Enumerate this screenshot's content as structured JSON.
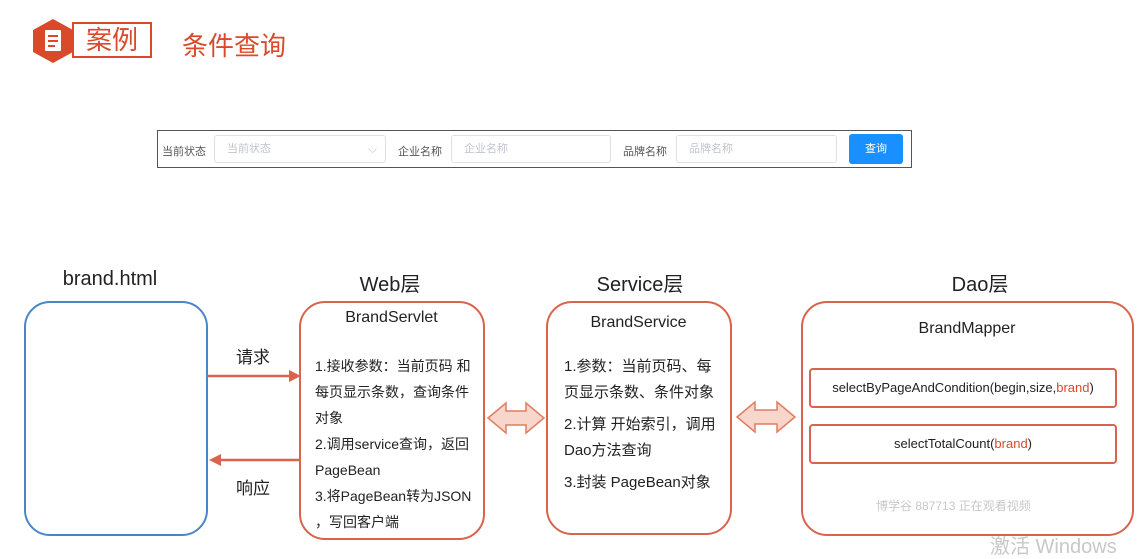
{
  "header": {
    "badge": "案例",
    "title": "条件查询"
  },
  "search_form": {
    "status_label": "当前状态",
    "status_placeholder": "当前状态",
    "company_label": "企业名称",
    "company_placeholder": "企业名称",
    "brand_label": "品牌名称",
    "brand_placeholder": "品牌名称",
    "query_button": "查询"
  },
  "diagram": {
    "col1_label": "brand.html",
    "col2_label": "Web层",
    "col3_label": "Service层",
    "col4_label": "Dao层",
    "request_label": "请求",
    "response_label": "响应",
    "web_box": {
      "title": "BrandServlet",
      "step1_line1": "1.接收参数：当前页码 和",
      "step1_line2": "每页显示条数，查询条件",
      "step1_line3": "对象",
      "step2_line1": "2.调用service查询，返回",
      "step2_line2": "PageBean",
      "step3_line1": "3.将PageBean转为JSON",
      "step3_line2": "，写回客户端"
    },
    "service_box": {
      "title": "BrandService",
      "step1_line1": "1.参数：当前页码、每",
      "step1_line2": "页显示条数、条件对象",
      "step2_line1": "2.计算 开始索引，调用",
      "step2_line2": "Dao方法查询",
      "step3": "3.封装 PageBean对象"
    },
    "dao_box": {
      "title": "BrandMapper",
      "method1_prefix": "selectByPageAndCondition(begin,size,",
      "method1_param": "brand",
      "method1_suffix": ")",
      "method2_prefix": "selectTotalCount(",
      "method2_param": "brand",
      "method2_suffix": ")"
    }
  },
  "watermark": {
    "text1": "博学谷 887713 正在观看视频",
    "text2": "激活 Windows"
  },
  "colors": {
    "accent_red": "#d94a2a",
    "box_red": "#d9634c",
    "box_blue": "#4a86c6",
    "button_blue": "#1890ff"
  }
}
